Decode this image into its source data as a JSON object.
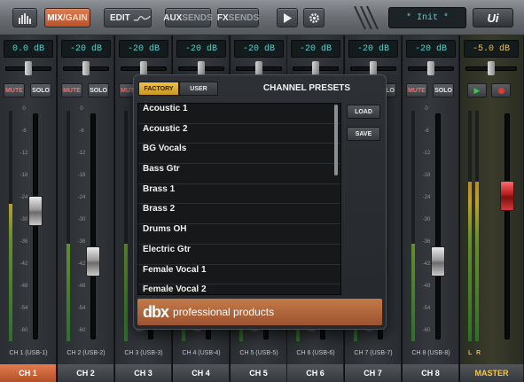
{
  "toolbar": {
    "mix_label": "MIX",
    "gain_label": "GAIN",
    "edit_label": "EDIT",
    "aux_label": "AUX",
    "aux_sends_label": "SENDS",
    "fx_label": "FX",
    "fx_sends_label": "SENDS",
    "preset_display": "* Init *",
    "logo_text": "Ui"
  },
  "channels": [
    {
      "gain": "0.0 dB",
      "usb": "CH 1 (USB-1)",
      "tab": "CH 1",
      "fader": 0.58
    },
    {
      "gain": "-20 dB",
      "usb": "CH 2 (USB-2)",
      "tab": "CH 2",
      "fader": 0.32
    },
    {
      "gain": "-20 dB",
      "usb": "CH 3 (USB-3)",
      "tab": "CH 3",
      "fader": 0.32
    },
    {
      "gain": "-20 dB",
      "usb": "CH 4 (USB-4)",
      "tab": "CH 4",
      "fader": 0.32
    },
    {
      "gain": "-20 dB",
      "usb": "CH 5 (USB-5)",
      "tab": "CH 5",
      "fader": 0.32
    },
    {
      "gain": "-20 dB",
      "usb": "CH 6 (USB-6)",
      "tab": "CH 6",
      "fader": 0.32
    },
    {
      "gain": "-20 dB",
      "usb": "CH 7 (USB-7)",
      "tab": "CH 7",
      "fader": 0.32
    },
    {
      "gain": "-20 dB",
      "usb": "CH 8 (USB-8)",
      "tab": "CH 8",
      "fader": 0.32
    }
  ],
  "strip_labels": {
    "mute": "MUTE",
    "solo": "SOLO"
  },
  "master": {
    "gain": "-5.0 dB",
    "l": "L",
    "r": "R",
    "tab": "MASTER"
  },
  "db_scale": [
    "0",
    "-6",
    "-12",
    "-18",
    "-24",
    "-30",
    "-36",
    "-42",
    "-48",
    "-54",
    "-60"
  ],
  "dialog": {
    "tab_factory": "FACTORY",
    "tab_user": "USER",
    "title": "CHANNEL PRESETS",
    "load_label": "LOAD",
    "save_label": "SAVE",
    "presets": [
      "Acoustic 1",
      "Acoustic 2",
      "BG Vocals",
      "Bass Gtr",
      "Brass 1",
      "Brass 2",
      "Drums OH",
      "Electric Gtr",
      "Female Vocal 1",
      "Female Vocal 2"
    ],
    "banner_logo": "dbx",
    "banner_tagline": "professional products"
  }
}
